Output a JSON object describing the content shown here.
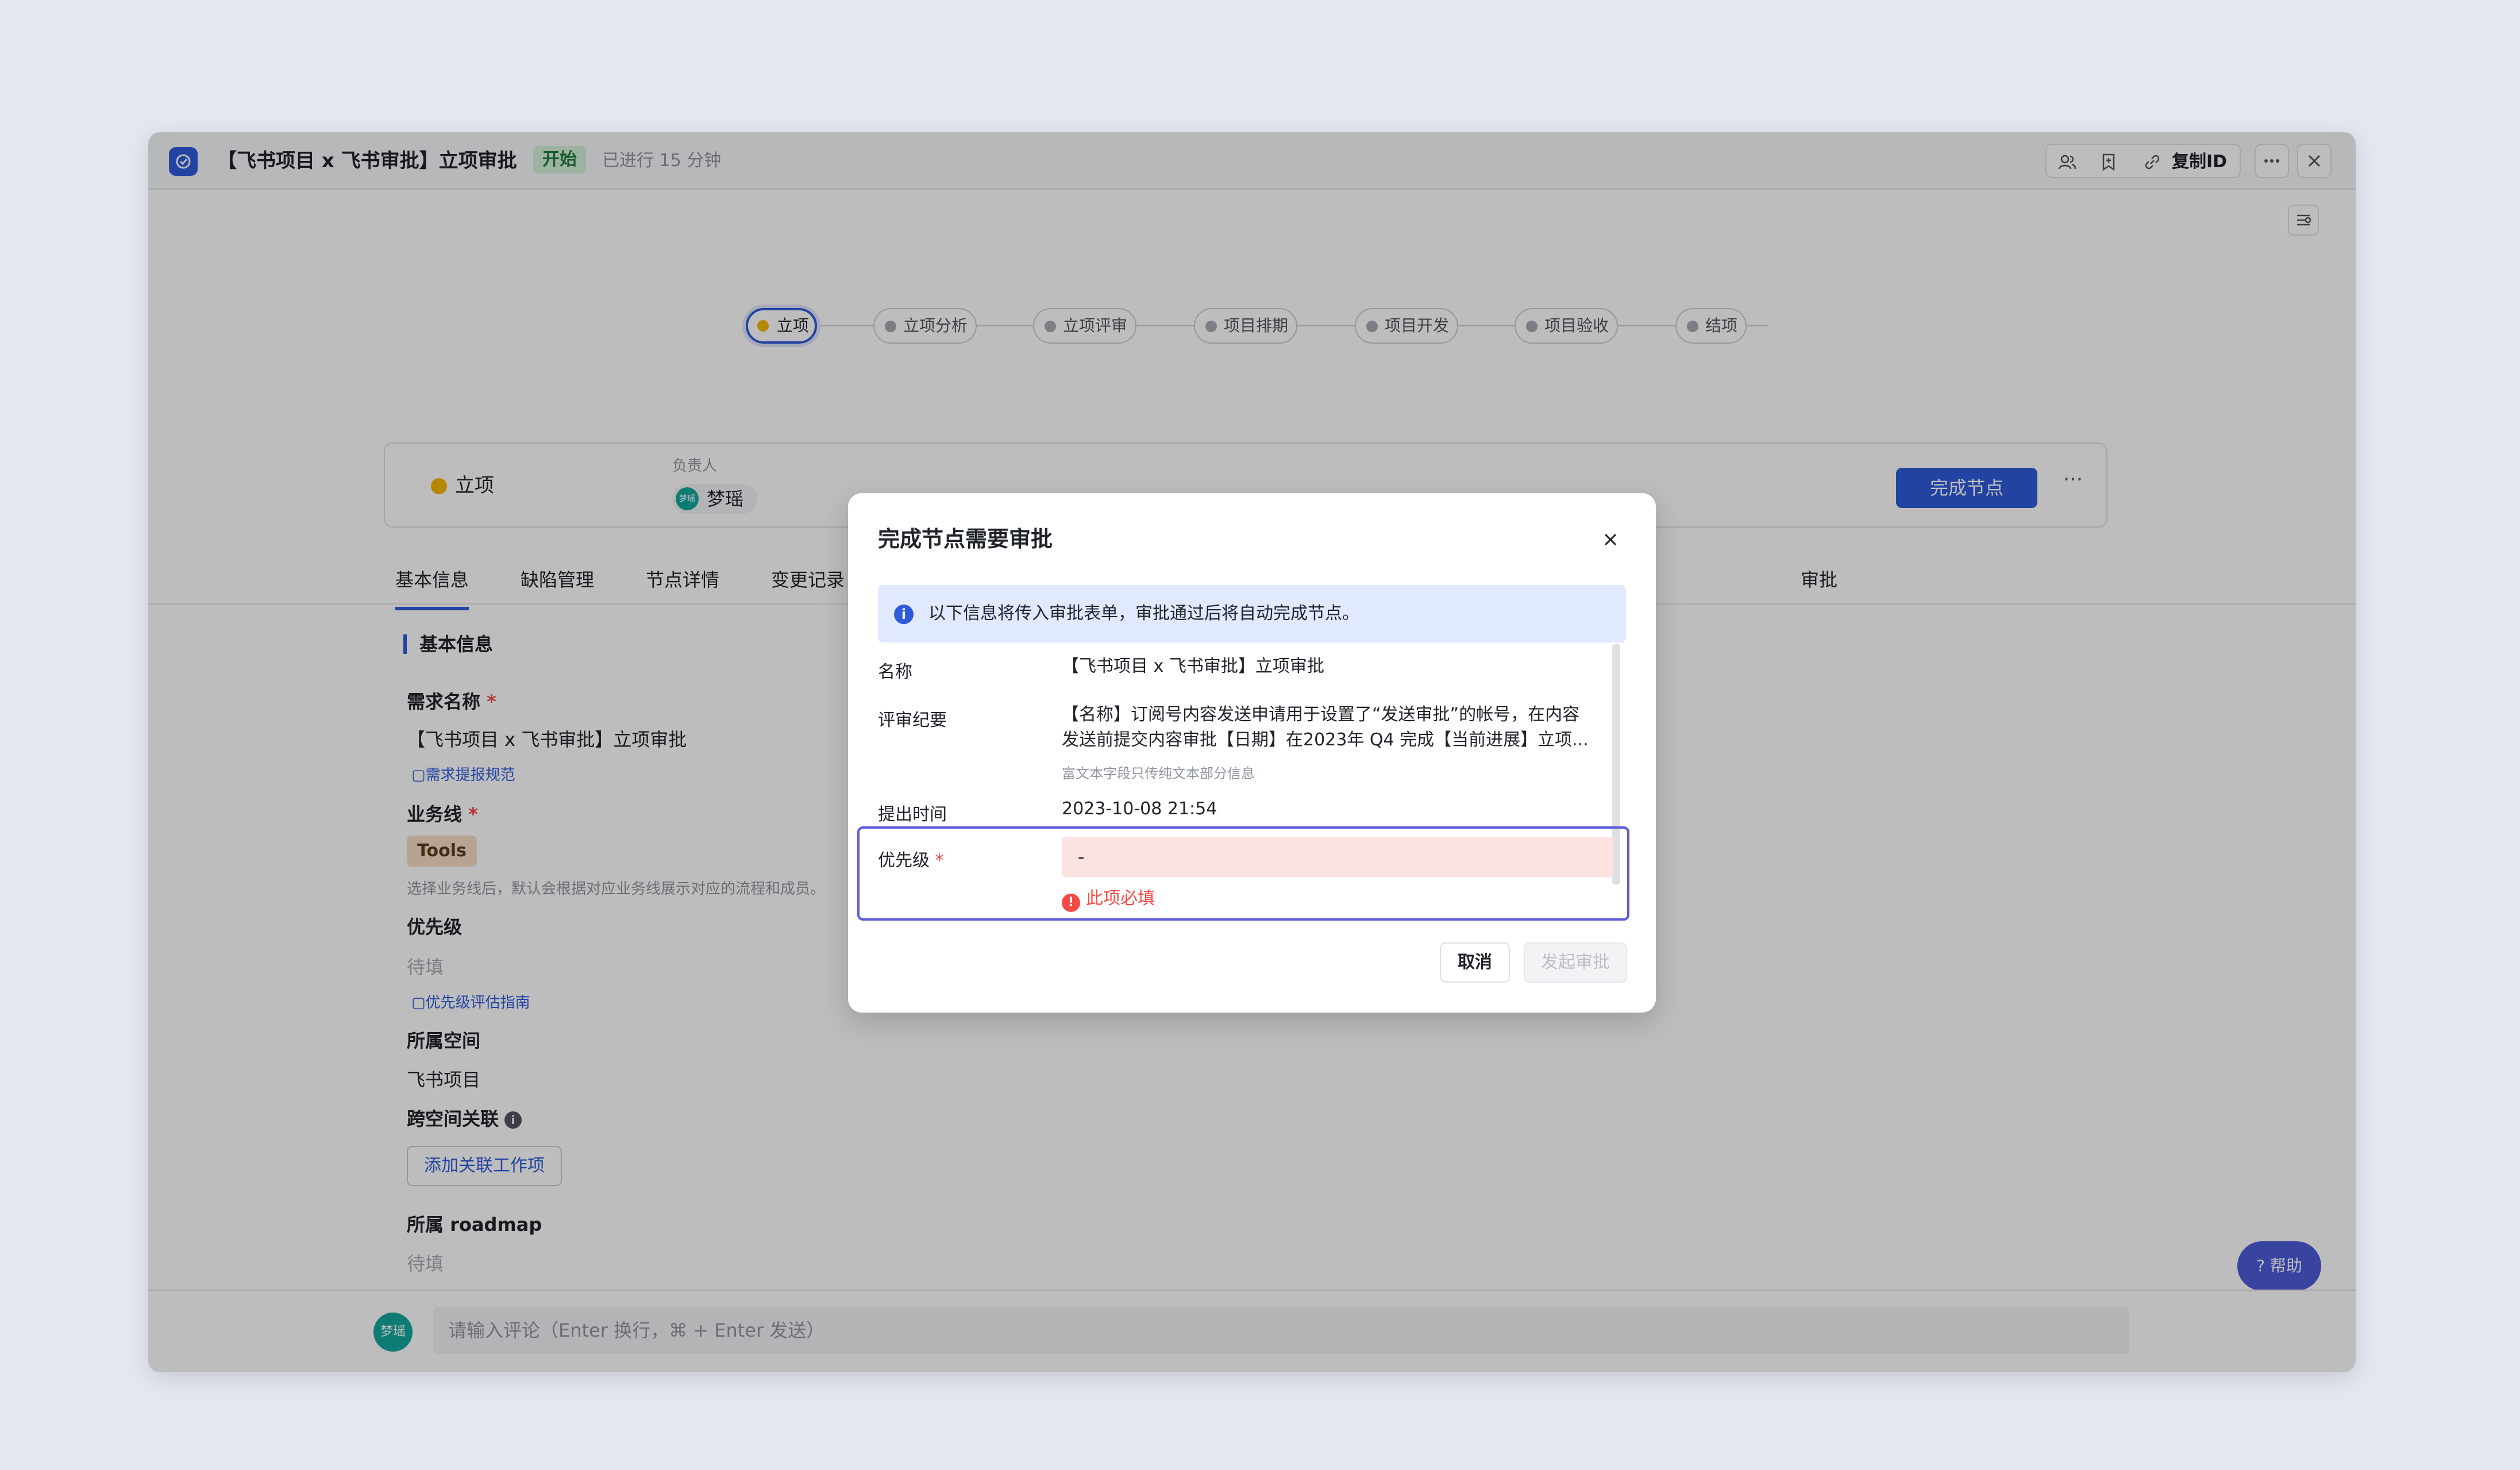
{
  "window": {
    "title": "【飞书项目 x 飞书审批】立项审批",
    "status_badge": "开始",
    "elapsed": "已进行 15 分钟",
    "copy_id_label": "复制ID"
  },
  "pipeline": {
    "stages": [
      "立项",
      "立项分析",
      "立项评审",
      "项目排期",
      "项目开发",
      "项目验收",
      "结项"
    ],
    "active_index": 0
  },
  "node_card": {
    "name": "立项",
    "owner_label": "负责人",
    "owner_name": "梦瑶",
    "owner_avatar_text": "梦瑶",
    "complete_button": "完成节点"
  },
  "tabs": [
    "基本信息",
    "缺陷管理",
    "节点详情",
    "变更记录",
    "审批"
  ],
  "form": {
    "section_title": "基本信息",
    "requirement_name_label": "需求名称",
    "requirement_name_value": "【飞书项目 x 飞书审批】立项审批",
    "requirement_guide_link": "需求提报规范",
    "business_line_label": "业务线",
    "business_line_tag": "Tools",
    "business_line_hint": "选择业务线后，默认会根据对应业务线展示对应的流程和成员。",
    "priority_label": "优先级",
    "priority_placeholder": "待填",
    "priority_guide_link": "优先级评估指南",
    "space_label": "所属空间",
    "space_value": "飞书项目",
    "cross_space_label": "跨空间关联",
    "add_link_button": "添加关联工作项",
    "roadmap_label": "所属 roadmap",
    "roadmap_placeholder": "待填"
  },
  "comment": {
    "avatar_text": "梦瑶",
    "placeholder": "请输入评论（Enter 换行，⌘ + Enter 发送）"
  },
  "help_button": "帮助",
  "dialog": {
    "title": "完成节点需要审批",
    "banner": "以下信息将传入审批表单，审批通过后将自动完成节点。",
    "fields": {
      "name_label": "名称",
      "name_value": "【飞书项目 x 飞书审批】立项审批",
      "summary_label": "评审纪要",
      "summary_line1": "【名称】订阅号内容发送申请用于设置了“发送审批”的帐号，在内容",
      "summary_line2": "发送前提交内容审批【日期】在2023年 Q4 完成【当前进展】立项...",
      "summary_note": "富文本字段只传纯文本部分信息",
      "time_label": "提出时间",
      "time_value": "2023-10-08 21:54",
      "priority_label": "优先级",
      "priority_value": "-",
      "priority_error": "此项必填"
    },
    "cancel_button": "取消",
    "submit_button": "发起审批"
  }
}
